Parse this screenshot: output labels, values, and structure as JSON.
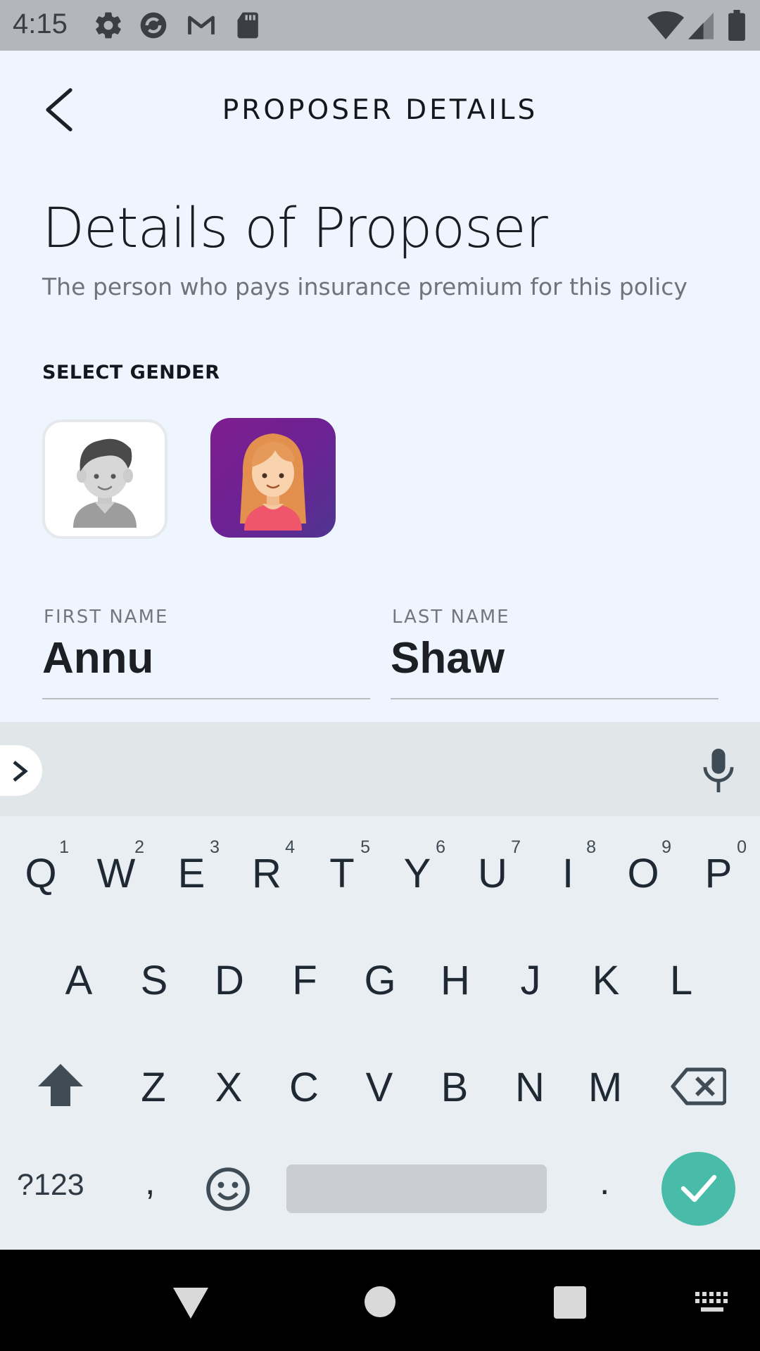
{
  "status_bar": {
    "time": "4:15",
    "icons": [
      "gear-icon",
      "sync-icon",
      "gmail-icon",
      "sd-card-icon",
      "wifi-icon",
      "signal-icon",
      "battery-icon"
    ]
  },
  "header": {
    "title": "PROPOSER DETAILS",
    "back_icon": "chevron-left-icon"
  },
  "main": {
    "title": "Details of Proposer",
    "subtitle": "The person who pays insurance premium for this policy",
    "gender_label": "SELECT GENDER",
    "gender_options": [
      {
        "name": "male",
        "selected": false,
        "icon": "male-avatar-icon"
      },
      {
        "name": "female",
        "selected": true,
        "icon": "female-avatar-icon"
      }
    ],
    "first_name": {
      "label": "FIRST NAME",
      "value": "Annu"
    },
    "last_name": {
      "label": "LAST NAME",
      "value": "Shaw"
    }
  },
  "keyboard": {
    "row1": [
      {
        "letter": "Q",
        "hint": "1"
      },
      {
        "letter": "W",
        "hint": "2"
      },
      {
        "letter": "E",
        "hint": "3"
      },
      {
        "letter": "R",
        "hint": "4"
      },
      {
        "letter": "T",
        "hint": "5"
      },
      {
        "letter": "Y",
        "hint": "6"
      },
      {
        "letter": "U",
        "hint": "7"
      },
      {
        "letter": "I",
        "hint": "8"
      },
      {
        "letter": "O",
        "hint": "9"
      },
      {
        "letter": "P",
        "hint": "0"
      }
    ],
    "row2": [
      "A",
      "S",
      "D",
      "F",
      "G",
      "H",
      "J",
      "K",
      "L"
    ],
    "row3": [
      "Z",
      "X",
      "C",
      "V",
      "B",
      "N",
      "M"
    ],
    "symbols_label": "?123",
    "comma_label": ",",
    "period_label": ".",
    "accent_color": "#48bca8"
  },
  "nav_bar": {
    "buttons": [
      "back-triangle-icon",
      "home-circle-icon",
      "recents-square-icon",
      "keyboard-switch-icon"
    ]
  }
}
